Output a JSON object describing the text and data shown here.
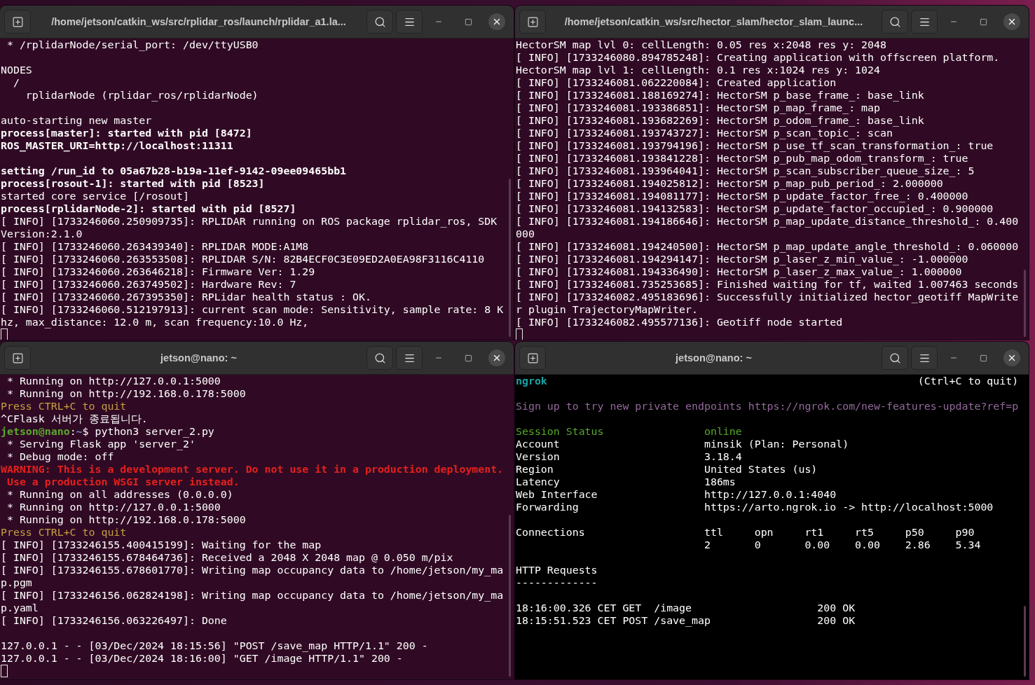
{
  "windows": [
    {
      "title": "/home/jetson/catkin_ws/src/rplidar_ros/launch/rplidar_a1.la...",
      "kind": "shell",
      "cursor": true,
      "lines": [
        {
          "text": " * /rplidarNode/serial_port: /dev/ttyUSB0",
          "color": "#ffffff",
          "bold": false
        },
        {
          "kind": "blank"
        },
        {
          "text": "NODES",
          "color": "#ffffff",
          "bold": false
        },
        {
          "text": "  /",
          "color": "#ffffff",
          "bold": false
        },
        {
          "text": "    rplidarNode (rplidar_ros/rplidarNode)",
          "color": "#ffffff",
          "bold": false
        },
        {
          "kind": "blank"
        },
        {
          "text": "auto-starting new master",
          "color": "#ffffff",
          "bold": false
        },
        {
          "text": "process[master]: started with pid [8472]",
          "color": "#ffffff",
          "bold": true
        },
        {
          "text": "ROS_MASTER_URI=http://localhost:11311",
          "color": "#ffffff",
          "bold": true
        },
        {
          "kind": "blank"
        },
        {
          "text": "setting /run_id to 05a67b28-b19a-11ef-9142-09ee09465bb1",
          "color": "#ffffff",
          "bold": true
        },
        {
          "text": "process[rosout-1]: started with pid [8523]",
          "color": "#ffffff",
          "bold": true
        },
        {
          "text": "started core service [/rosout]",
          "color": "#ffffff",
          "bold": false
        },
        {
          "text": "process[rplidarNode-2]: started with pid [8527]",
          "color": "#ffffff",
          "bold": true
        },
        {
          "text": "[ INFO] [1733246060.250909735]: RPLIDAR running on ROS package rplidar_ros, SDK",
          "color": "#ffffff",
          "bold": false
        },
        {
          "text": "Version:2.1.0",
          "color": "#ffffff",
          "bold": false
        },
        {
          "text": "[ INFO] [1733246060.263439340]: RPLIDAR MODE:A1M8",
          "color": "#ffffff",
          "bold": false
        },
        {
          "text": "[ INFO] [1733246060.263553508]: RPLIDAR S/N: 82B4ECF0C3E09ED2A0EA98F3116C4110",
          "color": "#ffffff",
          "bold": false
        },
        {
          "text": "[ INFO] [1733246060.263646218]: Firmware Ver: 1.29",
          "color": "#ffffff",
          "bold": false
        },
        {
          "text": "[ INFO] [1733246060.263749502]: Hardware Rev: 7",
          "color": "#ffffff",
          "bold": false
        },
        {
          "text": "[ INFO] [1733246060.267395350]: RPLidar health status : OK.",
          "color": "#ffffff",
          "bold": false
        },
        {
          "text": "[ INFO] [1733246060.512197913]: current scan mode: Sensitivity, sample rate: 8 K",
          "color": "#ffffff",
          "bold": false
        },
        {
          "text": "hz, max_distance: 12.0 m, scan frequency:10.0 Hz,",
          "color": "#ffffff",
          "bold": false
        }
      ]
    },
    {
      "title": "/home/jetson/catkin_ws/src/hector_slam/hector_slam_launc...",
      "kind": "shell",
      "cursor": true,
      "lines": [
        {
          "text": "HectorSM map lvl 0: cellLength: 0.05 res x:2048 res y: 2048",
          "color": "#ffffff",
          "bold": false
        },
        {
          "text": "[ INFO] [1733246080.894785248]: Creating application with offscreen platform.",
          "color": "#ffffff",
          "bold": false
        },
        {
          "text": "HectorSM map lvl 1: cellLength: 0.1 res x:1024 res y: 1024",
          "color": "#ffffff",
          "bold": false
        },
        {
          "text": "[ INFO] [1733246081.062220084]: Created application",
          "color": "#ffffff",
          "bold": false
        },
        {
          "text": "[ INFO] [1733246081.188169274]: HectorSM p_base_frame_: base_link",
          "color": "#ffffff",
          "bold": false
        },
        {
          "text": "[ INFO] [1733246081.193386851]: HectorSM p_map_frame_: map",
          "color": "#ffffff",
          "bold": false
        },
        {
          "text": "[ INFO] [1733246081.193682269]: HectorSM p_odom_frame_: base_link",
          "color": "#ffffff",
          "bold": false
        },
        {
          "text": "[ INFO] [1733246081.193743727]: HectorSM p_scan_topic_: scan",
          "color": "#ffffff",
          "bold": false
        },
        {
          "text": "[ INFO] [1733246081.193794196]: HectorSM p_use_tf_scan_transformation_: true",
          "color": "#ffffff",
          "bold": false
        },
        {
          "text": "[ INFO] [1733246081.193841228]: HectorSM p_pub_map_odom_transform_: true",
          "color": "#ffffff",
          "bold": false
        },
        {
          "text": "[ INFO] [1733246081.193964041]: HectorSM p_scan_subscriber_queue_size_: 5",
          "color": "#ffffff",
          "bold": false
        },
        {
          "text": "[ INFO] [1733246081.194025812]: HectorSM p_map_pub_period_: 2.000000",
          "color": "#ffffff",
          "bold": false
        },
        {
          "text": "[ INFO] [1733246081.194081177]: HectorSM p_update_factor_free_: 0.400000",
          "color": "#ffffff",
          "bold": false
        },
        {
          "text": "[ INFO] [1733246081.194132583]: HectorSM p_update_factor_occupied_: 0.900000",
          "color": "#ffffff",
          "bold": false
        },
        {
          "text": "[ INFO] [1733246081.194186646]: HectorSM p_map_update_distance_threshold_: 0.400",
          "color": "#ffffff",
          "bold": false
        },
        {
          "text": "000",
          "color": "#ffffff",
          "bold": false
        },
        {
          "text": "[ INFO] [1733246081.194240500]: HectorSM p_map_update_angle_threshold_: 0.060000",
          "color": "#ffffff",
          "bold": false
        },
        {
          "text": "[ INFO] [1733246081.194294147]: HectorSM p_laser_z_min_value_: -1.000000",
          "color": "#ffffff",
          "bold": false
        },
        {
          "text": "[ INFO] [1733246081.194336490]: HectorSM p_laser_z_max_value_: 1.000000",
          "color": "#ffffff",
          "bold": false
        },
        {
          "text": "[ INFO] [1733246081.735253685]: Finished waiting for tf, waited 1.007463 seconds",
          "color": "#ffffff",
          "bold": false
        },
        {
          "text": "[ INFO] [1733246082.495183696]: Successfully initialized hector_geotiff MapWrite",
          "color": "#ffffff",
          "bold": false
        },
        {
          "text": "r plugin TrajectoryMapWriter.",
          "color": "#ffffff",
          "bold": false
        },
        {
          "text": "[ INFO] [1733246082.495577136]: Geotiff node started",
          "color": "#ffffff",
          "bold": false
        }
      ]
    },
    {
      "title": "jetson@nano: ~",
      "kind": "shell",
      "cursor": true,
      "lines": [
        {
          "text": " * Running on http://127.0.0.1:5000",
          "color": "#ffffff",
          "bold": false
        },
        {
          "text": " * Running on http://192.168.0.178:5000",
          "color": "#ffffff",
          "bold": false
        },
        {
          "text": "Press CTRL+C to quit",
          "color": "#c5a040",
          "bold": false
        },
        {
          "text": "^CFlask 서버가 종료됩니다.",
          "color": "#ffffff",
          "bold": false
        },
        {
          "spans": [
            {
              "text": "jetson@nano",
              "color": "#5aa92c",
              "bold": true
            },
            {
              "text": ":",
              "color": "#ffffff",
              "bold": false
            },
            {
              "text": "~",
              "color": "#6b94d6",
              "bold": true
            },
            {
              "text": "$ python3 server_2.py",
              "color": "#ffffff",
              "bold": false
            }
          ]
        },
        {
          "text": " * Serving Flask app 'server_2'",
          "color": "#ffffff",
          "bold": false
        },
        {
          "text": " * Debug mode: off",
          "color": "#ffffff",
          "bold": false
        },
        {
          "text": "WARNING: This is a development server. Do not use it in a production deployment.",
          "color": "#e5201d",
          "bold": true
        },
        {
          "text": " Use a production WSGI server instead.",
          "color": "#e5201d",
          "bold": true
        },
        {
          "text": " * Running on all addresses (0.0.0.0)",
          "color": "#ffffff",
          "bold": false
        },
        {
          "text": " * Running on http://127.0.0.1:5000",
          "color": "#ffffff",
          "bold": false
        },
        {
          "text": " * Running on http://192.168.0.178:5000",
          "color": "#ffffff",
          "bold": false
        },
        {
          "text": "Press CTRL+C to quit",
          "color": "#c5a040",
          "bold": false
        },
        {
          "text": "[ INFO] [1733246155.400415199]: Waiting for the map",
          "color": "#ffffff",
          "bold": false
        },
        {
          "text": "[ INFO] [1733246155.678464736]: Received a 2048 X 2048 map @ 0.050 m/pix",
          "color": "#ffffff",
          "bold": false
        },
        {
          "text": "[ INFO] [1733246155.678601770]: Writing map occupancy data to /home/jetson/my_ma",
          "color": "#ffffff",
          "bold": false
        },
        {
          "text": "p.pgm",
          "color": "#ffffff",
          "bold": false
        },
        {
          "text": "[ INFO] [1733246156.062824198]: Writing map occupancy data to /home/jetson/my_ma",
          "color": "#ffffff",
          "bold": false
        },
        {
          "text": "p.yaml",
          "color": "#ffffff",
          "bold": false
        },
        {
          "text": "[ INFO] [1733246156.063226497]: Done",
          "color": "#ffffff",
          "bold": false
        },
        {
          "kind": "blank"
        },
        {
          "text": "127.0.0.1 - - [03/Dec/2024 18:15:56] \"POST /save_map HTTP/1.1\" 200 -",
          "color": "#ffffff",
          "bold": false
        },
        {
          "text": "127.0.0.1 - - [03/Dec/2024 18:16:00] \"GET /image HTTP/1.1\" 200 -",
          "color": "#ffffff",
          "bold": false
        }
      ]
    },
    {
      "title": "jetson@nano: ~",
      "kind": "ngrok",
      "cursor": false,
      "lines": [
        {
          "spans": [
            {
              "text": "ngrok",
              "color": "#1aa3a3",
              "bold": true
            },
            {
              "text": "                                                           (Ctrl+C to quit)",
              "color": "#ffffff",
              "bold": false
            }
          ]
        },
        {
          "kind": "blank"
        },
        {
          "text": "Sign up to try new private endpoints https://ngrok.com/new-features-update?ref=p",
          "color": "#93699b",
          "bold": false
        },
        {
          "kind": "blank"
        },
        {
          "text": "Session Status                online",
          "color": "#56a82a",
          "bold": false
        },
        {
          "text": "Account                       minsik (Plan: Personal)",
          "color": "#ffffff",
          "bold": false
        },
        {
          "text": "Version                       3.18.4",
          "color": "#ffffff",
          "bold": false
        },
        {
          "text": "Region                        United States (us)",
          "color": "#ffffff",
          "bold": false
        },
        {
          "text": "Latency                       186ms",
          "color": "#ffffff",
          "bold": false
        },
        {
          "text": "Web Interface                 http://127.0.0.1:4040",
          "color": "#ffffff",
          "bold": false
        },
        {
          "text": "Forwarding                    https://arto.ngrok.io -> http://localhost:5000",
          "color": "#ffffff",
          "bold": false
        },
        {
          "kind": "blank"
        },
        {
          "text": "Connections                   ttl     opn     rt1     rt5     p50     p90",
          "color": "#ffffff",
          "bold": false
        },
        {
          "text": "                              2       0       0.00    0.00    2.86    5.34",
          "color": "#ffffff",
          "bold": false
        },
        {
          "kind": "blank"
        },
        {
          "text": "HTTP Requests",
          "color": "#ffffff",
          "bold": false
        },
        {
          "text": "-------------",
          "color": "#ffffff",
          "bold": false
        },
        {
          "kind": "blank"
        },
        {
          "text": "18:16:00.326 CET GET  /image                    200 OK",
          "color": "#ffffff",
          "bold": false
        },
        {
          "text": "18:15:51.523 CET POST /save_map                 200 OK",
          "color": "#ffffff",
          "bold": false
        }
      ]
    }
  ]
}
